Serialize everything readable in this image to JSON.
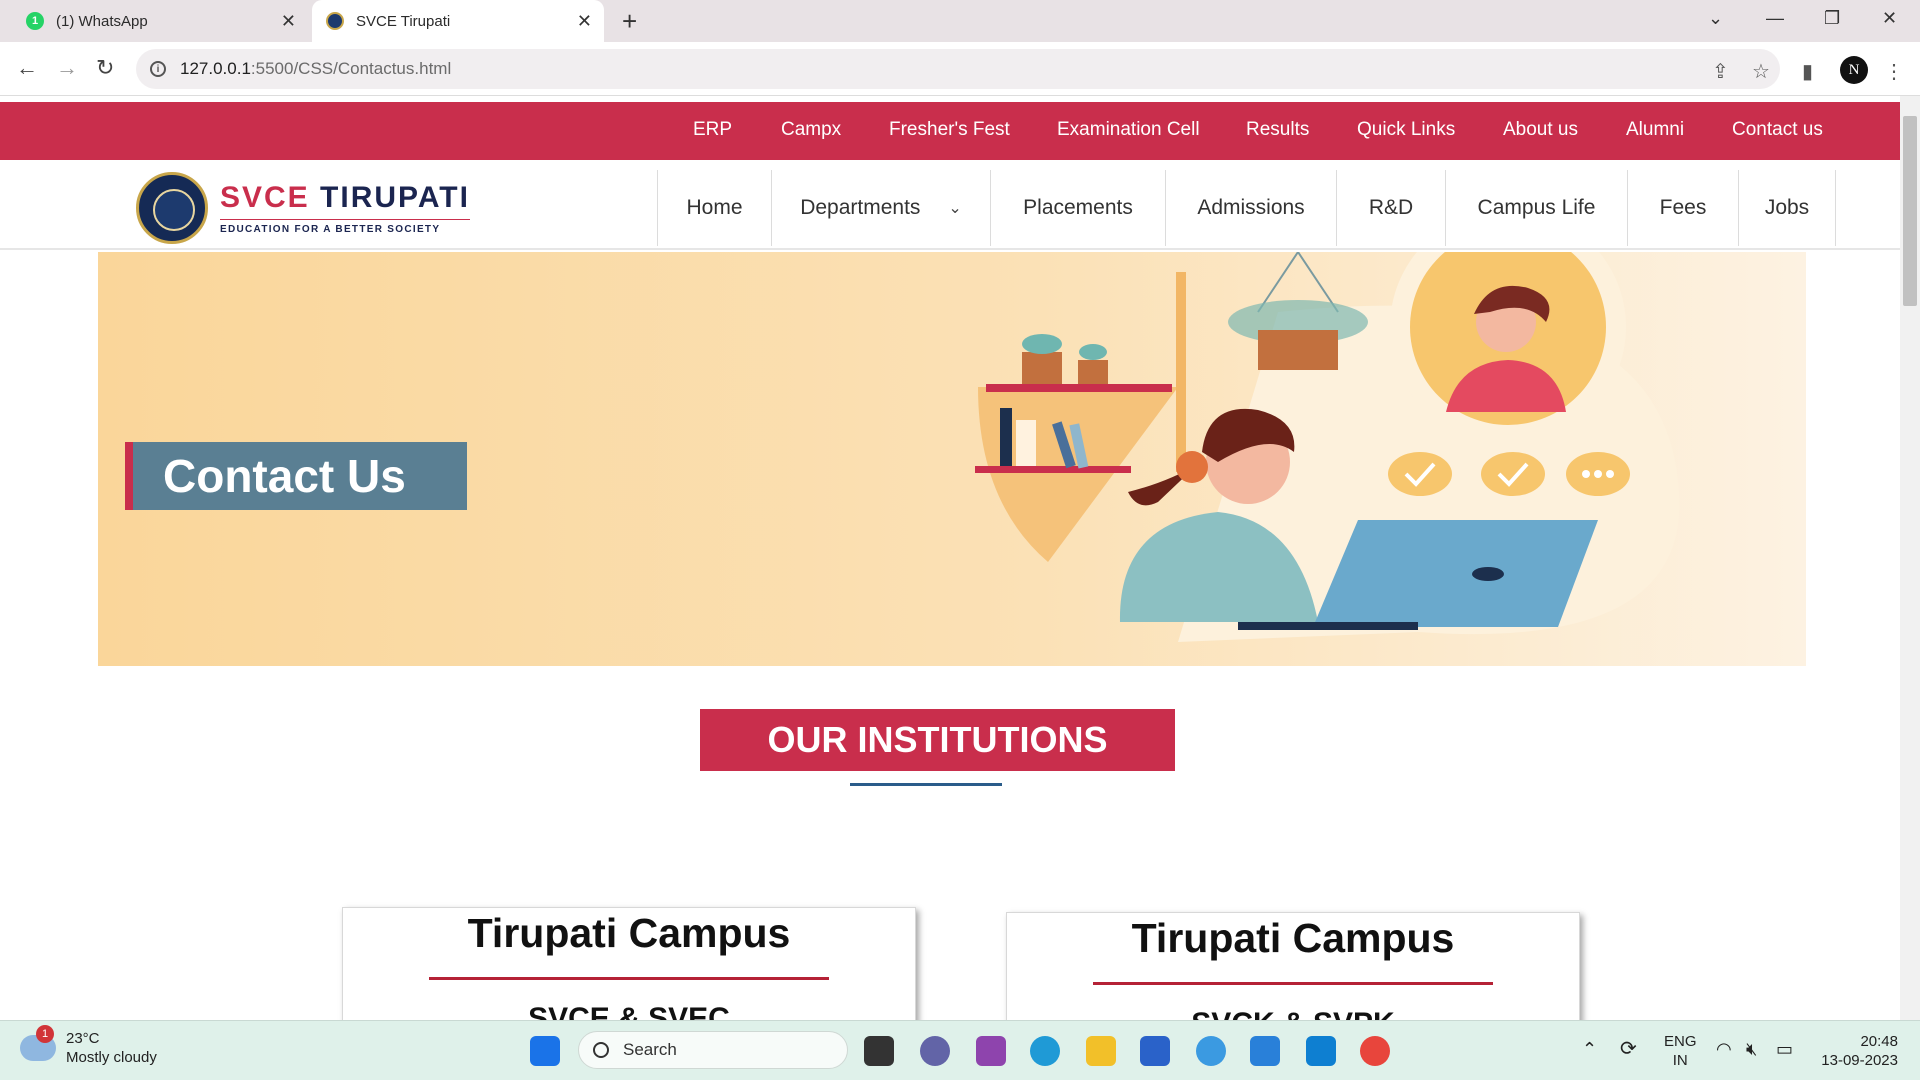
{
  "browser": {
    "tabs": [
      {
        "title": "(1) WhatsApp",
        "badge": "1"
      },
      {
        "title": "SVCE Tirupati"
      }
    ],
    "url_host": "127.0.0.1",
    "url_path": ":5500/CSS/Contactus.html",
    "profile_initial": "N"
  },
  "site": {
    "top_links": [
      "ERP",
      "Campx",
      "Fresher's Fest",
      "Examination Cell",
      "Results",
      "Quick Links",
      "About us",
      "Alumni",
      "Contact us"
    ],
    "logo": {
      "name_red": "SVCE",
      "name_dark": "TIRUPATI",
      "tagline": "EDUCATION FOR A BETTER SOCIETY"
    },
    "nav": [
      "Home",
      "Departments",
      "Placements",
      "Admissions",
      "R&D",
      "Campus Life",
      "Fees",
      "Jobs"
    ],
    "banner_heading": "Contact Us",
    "section_title": "OUR INSTITUTIONS",
    "cards": [
      {
        "title": "Tirupati Campus",
        "subtitle": "SVCE & SVEC"
      },
      {
        "title": "Tirupati Campus",
        "subtitle": "SVCK & SVPK"
      }
    ],
    "colors": {
      "brand_red": "#c92e4c",
      "banner_box": "#5a7f93",
      "navy": "#1b2550"
    }
  },
  "taskbar": {
    "weather_badge": "1",
    "temperature": "23°C",
    "condition": "Mostly cloudy",
    "search_label": "Search",
    "lang_top": "ENG",
    "lang_bottom": "IN",
    "time": "20:48",
    "date": "13-09-2023"
  }
}
